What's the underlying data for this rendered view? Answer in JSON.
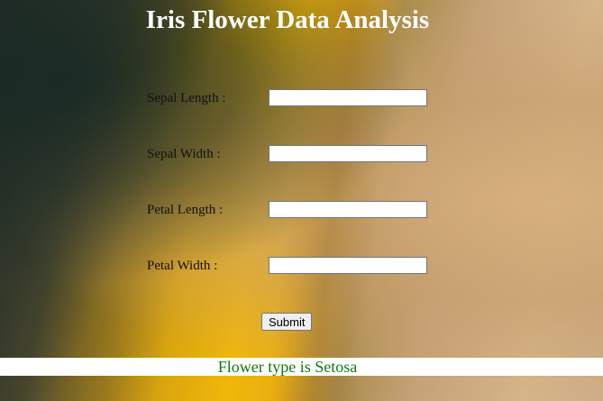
{
  "header": {
    "title": "Iris Flower Data Analysis"
  },
  "form": {
    "fields": [
      {
        "label": "Sepal Length :",
        "value": "",
        "placeholder": ""
      },
      {
        "label": "Sepal Width :",
        "value": "",
        "placeholder": ""
      },
      {
        "label": "Petal Length :",
        "value": "",
        "placeholder": ""
      },
      {
        "label": "Petal Width :",
        "value": "",
        "placeholder": ""
      }
    ],
    "submit_label": "Submit"
  },
  "result": {
    "text": "Flower type is Setosa",
    "color": "#0f7a0f"
  },
  "colors": {
    "title": "#ffffff",
    "background_accent": "#f0b70a"
  }
}
